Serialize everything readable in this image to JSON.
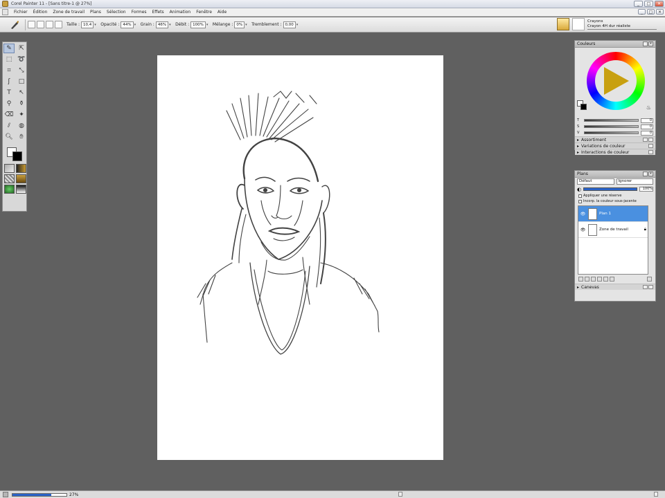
{
  "window": {
    "title": "Corel Painter 11 - [Sans titre-1 @ 27%]",
    "minimize": "_",
    "maximize": "□",
    "close": "✕"
  },
  "menu": [
    "Fichier",
    "Édition",
    "Zone de travail",
    "Plans",
    "Sélection",
    "Formes",
    "Effets",
    "Animation",
    "Fenêtre",
    "Aide"
  ],
  "property_bar": {
    "size_label": "Taille :",
    "size_value": "10,4",
    "opacity_label": "Opacité :",
    "opacity_value": "44%",
    "grain_label": "Grain :",
    "grain_value": "46%",
    "flow_label": "Débit :",
    "flow_value": "100%",
    "mix_label": "Mélange :",
    "mix_value": "0%",
    "jitter_label": "Tremblement :",
    "jitter_value": "0,00"
  },
  "brush_selector": {
    "category": "Crayons",
    "variant": "Crayon 4H dur réaliste"
  },
  "colors_panel": {
    "title": "Couleurs",
    "h_label": "T",
    "s_label": "S",
    "v_label": "V",
    "h_value": "0",
    "s_value": "0",
    "v_value": "0",
    "sub_panels": [
      "Assortiment",
      "Variations de couleur",
      "Interactions de couleur"
    ]
  },
  "layers_panel": {
    "title": "Plans",
    "composite_method": "Défaut",
    "blend_mode": "Ignorer",
    "opacity_value": "100%",
    "option_pick_up": "Appliquer une réserve",
    "option_preserve": "Incorp. la couleur sous-jacente",
    "layers": [
      {
        "name": "Plan 1",
        "selected": true
      },
      {
        "name": "Zone de travail",
        "selected": false
      }
    ],
    "next_panel": "Canevas"
  },
  "status": {
    "zoom": "27%"
  },
  "colors": {
    "accent": "#4a90e0",
    "canvas": "#ffffff",
    "desktop": "#606060"
  }
}
